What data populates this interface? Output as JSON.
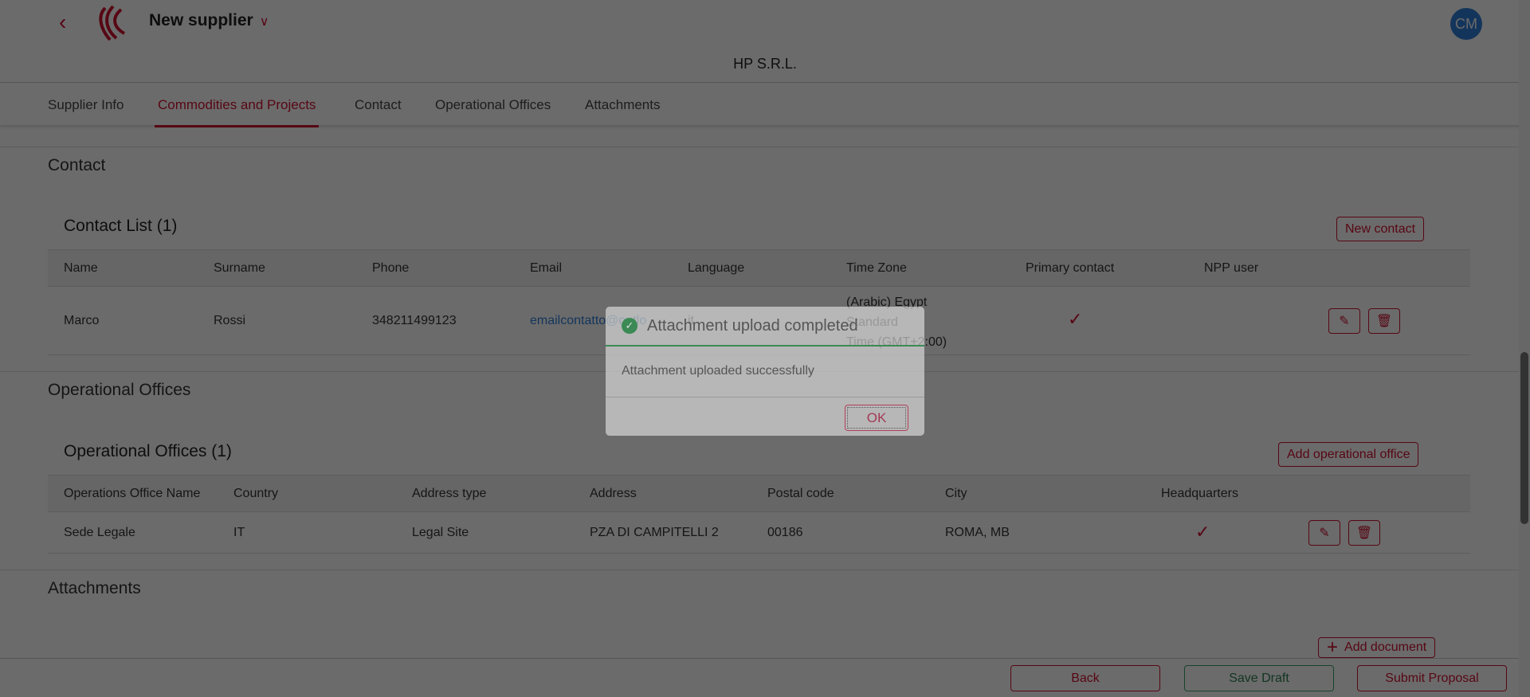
{
  "header": {
    "title": "New supplier",
    "company": "HP S.R.L.",
    "avatar": "CM"
  },
  "tabs": [
    "Supplier Info",
    "Commodities and Projects",
    "Contact",
    "Operational Offices",
    "Attachments"
  ],
  "contact": {
    "section": "Contact",
    "list_title": "Contact List (1)",
    "new_button": "New contact",
    "columns": [
      "Name",
      "Surname",
      "Phone",
      "Email",
      "Language",
      "Time Zone",
      "Primary contact",
      "NPP user"
    ],
    "rows": [
      {
        "name": "Marco",
        "surname": "Rossi",
        "phone": "348211499123",
        "email": "emailcontatto@outlo",
        "language": "it",
        "tz1": "(Arabic) Egypt",
        "tz2": "Standard",
        "tz3": "Time (GMT+2:00)",
        "primary": "✓"
      }
    ]
  },
  "offices": {
    "section": "Operational Offices",
    "list_title": "Operational Offices (1)",
    "add_button": "Add operational office",
    "columns": [
      "Operations Office Name",
      "Country",
      "Address type",
      "Address",
      "Postal code",
      "City",
      "Headquarters"
    ],
    "rows": [
      {
        "name": "Sede Legale",
        "country": "IT",
        "type": "Legal Site",
        "address": "PZA DI CAMPITELLI 2",
        "postal": "00186",
        "city": "ROMA, MB",
        "hq": "✓"
      }
    ]
  },
  "attachments": {
    "section": "Attachments",
    "add_button": "Add document"
  },
  "footer": {
    "back": "Back",
    "save": "Save Draft",
    "submit": "Submit Proposal"
  },
  "dialog": {
    "title": "Attachment upload completed",
    "message": "Attachment uploaded successfully",
    "ok": "OK"
  }
}
